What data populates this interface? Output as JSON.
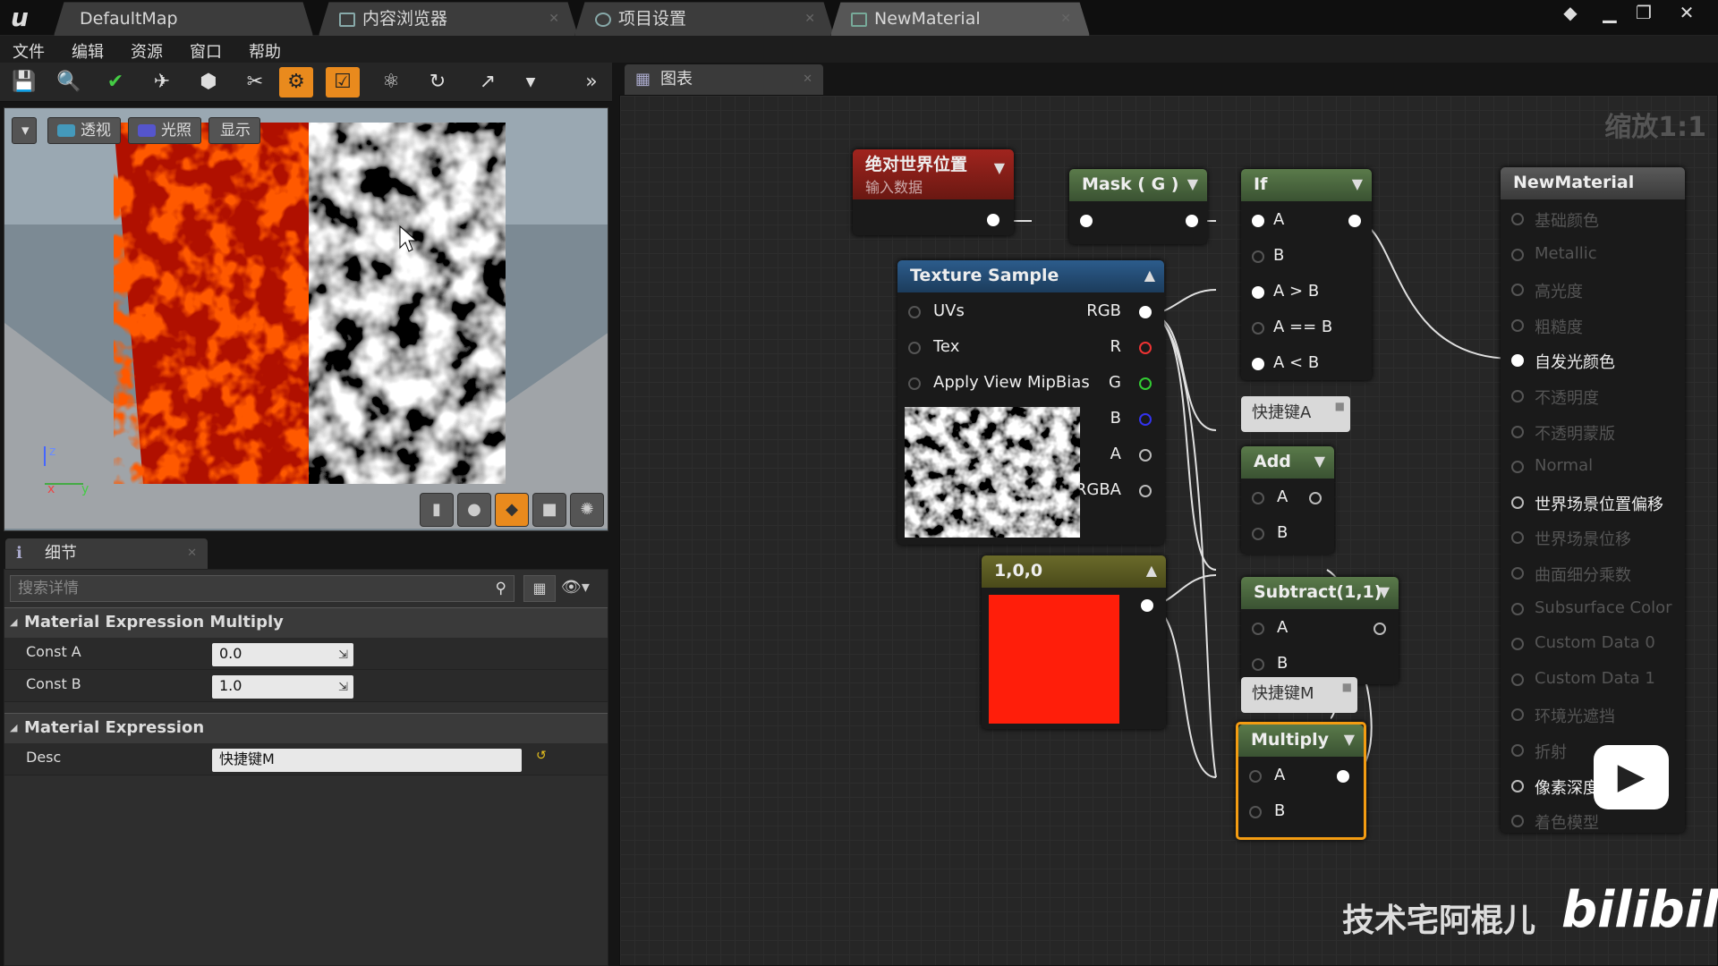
{
  "titlebar": {
    "tabs": [
      {
        "label": "DefaultMap"
      },
      {
        "label": "内容浏览器"
      },
      {
        "label": "项目设置"
      },
      {
        "label": "NewMaterial"
      }
    ]
  },
  "menu": [
    "文件",
    "编辑",
    "资源",
    "窗口",
    "帮助"
  ],
  "viewport": {
    "perspective": "透视",
    "lit": "光照",
    "show": "显示"
  },
  "details": {
    "tab": "细节",
    "search_placeholder": "搜索详情",
    "sections": [
      {
        "title": "Material Expression Multiply"
      },
      {
        "title": "Material Expression"
      }
    ],
    "const_a_label": "Const A",
    "const_a": "0.0",
    "const_b_label": "Const B",
    "const_b": "1.0",
    "desc_label": "Desc",
    "desc": "快捷键M"
  },
  "graph": {
    "tab": "图表",
    "zoom": "缩放1:1",
    "nodes": {
      "world_pos": {
        "title": "绝对世界位置",
        "subtitle": "输入数据"
      },
      "mask": {
        "title": "Mask ( G )"
      },
      "if": {
        "title": "If",
        "pins": [
          "A",
          "B",
          "A > B",
          "A == B",
          "A < B"
        ]
      },
      "texture": {
        "title": "Texture Sample",
        "inputs": [
          "UVs",
          "Tex",
          "Apply View MipBias"
        ],
        "outputs": [
          "RGB",
          "R",
          "G",
          "B",
          "A",
          "RGBA"
        ]
      },
      "const": {
        "title": "1,0,0",
        "color": "#ff1e0a"
      },
      "add": {
        "title": "Add",
        "pins": [
          "A",
          "B"
        ]
      },
      "subtract": {
        "title": "Subtract(1,1)",
        "pins": [
          "A",
          "B"
        ]
      },
      "multiply": {
        "title": "Multiply",
        "pins": [
          "A",
          "B"
        ]
      },
      "material": {
        "title": "NewMaterial",
        "pins": [
          "基础颜色",
          "Metallic",
          "高光度",
          "粗糙度",
          "自发光颜色",
          "不透明度",
          "不透明蒙版",
          "Normal",
          "世界场景位置偏移",
          "世界场景位移",
          "曲面细分乘数",
          "Subsurface Color",
          "Custom Data 0",
          "Custom Data 1",
          "环境光遮挡",
          "折射",
          "像素深度偏移",
          "着色模型"
        ]
      }
    },
    "comments": {
      "a": "快捷键A",
      "m": "快捷键M"
    }
  },
  "watermark": {
    "author": "技术宅阿棍儿",
    "brand": "bilibili"
  },
  "colors": {
    "accent": "#e98a1d",
    "selected_border": "#f39c12"
  }
}
